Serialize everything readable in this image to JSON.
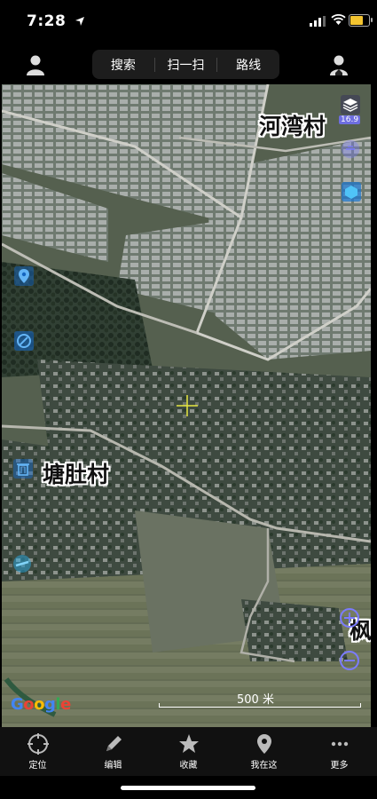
{
  "status_bar": {
    "time": "7:28"
  },
  "toolbar": {
    "search": "搜索",
    "scan": "扫一扫",
    "route": "路线"
  },
  "map": {
    "labels": {
      "village_1": "河湾村",
      "village_2": "塘肚村",
      "village_3": "枫"
    },
    "zoom_level": "16.9",
    "scale_text": "500 米",
    "attribution": "Google",
    "attribution_colors": [
      "#4285f4",
      "#ea4335",
      "#fbbc05",
      "#4285f4",
      "#34a853",
      "#ea4335"
    ],
    "accent": "#7b7bff"
  },
  "tabs": [
    {
      "label": "定位",
      "icon": "locate-icon"
    },
    {
      "label": "编辑",
      "icon": "pencil-icon"
    },
    {
      "label": "收藏",
      "icon": "star-icon"
    },
    {
      "label": "我在这",
      "icon": "pin-icon"
    },
    {
      "label": "更多",
      "icon": "more-icon"
    }
  ]
}
